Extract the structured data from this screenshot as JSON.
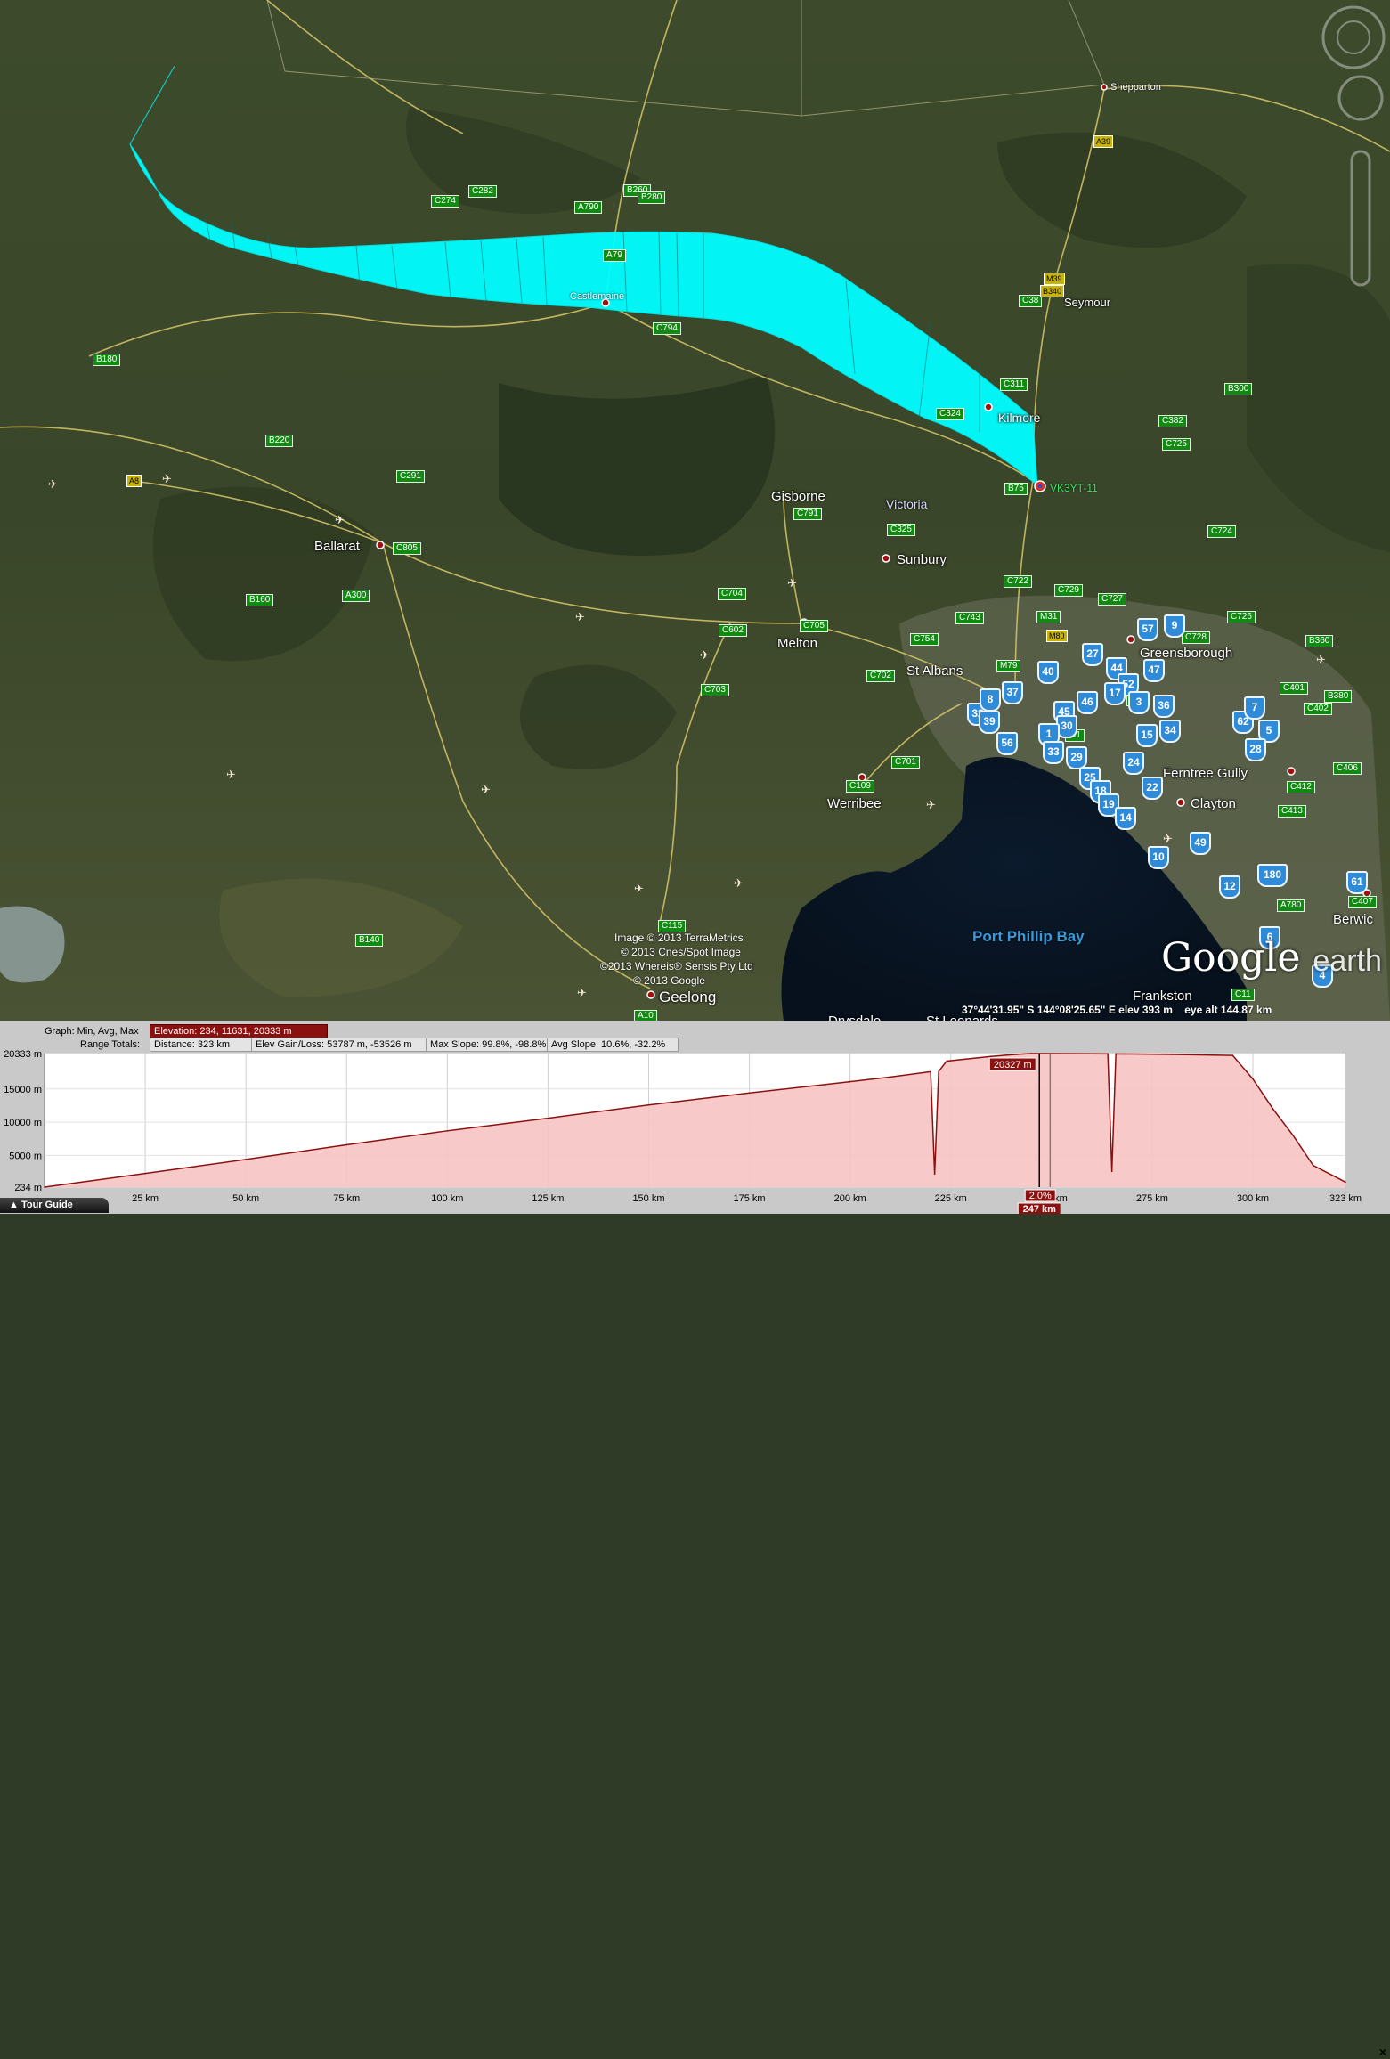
{
  "map": {
    "towns": [
      {
        "name": "Shepparton",
        "cls": "town-sm"
      },
      {
        "name": "Castlemaine",
        "cls": "town-sm"
      },
      {
        "name": "Seymour",
        "cls": "town"
      },
      {
        "name": "Kilmore",
        "cls": "town"
      },
      {
        "name": "Gisborne",
        "cls": "town"
      },
      {
        "name": "Victoria",
        "cls": "town"
      },
      {
        "name": "Sunbury",
        "cls": "town"
      },
      {
        "name": "Ballarat",
        "cls": "town"
      },
      {
        "name": "Melton",
        "cls": "town"
      },
      {
        "name": "St Albans",
        "cls": "town"
      },
      {
        "name": "Greensborough",
        "cls": "town"
      },
      {
        "name": "Ferntree Gully",
        "cls": "town"
      },
      {
        "name": "Clayton",
        "cls": "town"
      },
      {
        "name": "Werribee",
        "cls": "town"
      },
      {
        "name": "Geelong",
        "cls": "town"
      },
      {
        "name": "Frankston",
        "cls": "town"
      },
      {
        "name": "Berwic",
        "cls": "town"
      },
      {
        "name": "Drysdale",
        "cls": "town"
      },
      {
        "name": "St Leonards",
        "cls": "town"
      }
    ],
    "water_label": "Port Phillip Bay",
    "tracker_label": "VK3YT-11",
    "roads": [
      "C282",
      "C274",
      "B260",
      "B280",
      "A790",
      "A79",
      "C38",
      "B340",
      "M39",
      "A39",
      "C794",
      "B180",
      "C311",
      "C324",
      "B300",
      "C382",
      "C725",
      "B220",
      "A8",
      "C291",
      "B75",
      "C724",
      "C791",
      "C325",
      "C805",
      "C722",
      "C729",
      "C727",
      "A300",
      "C704",
      "B160",
      "C705",
      "C602",
      "C743",
      "M31",
      "M80",
      "C726",
      "C728",
      "B360",
      "C754",
      "M79",
      "C702",
      "C703",
      "M3",
      "M1",
      "C401",
      "B380",
      "C402",
      "C406",
      "C412",
      "C413",
      "C701",
      "C109",
      "A780",
      "C407",
      "B140",
      "C115",
      "A10",
      "C11"
    ],
    "poi_shields": [
      "57",
      "9",
      "27",
      "44",
      "47",
      "40",
      "52",
      "36",
      "37",
      "46",
      "62",
      "7",
      "32",
      "39",
      "45",
      "30",
      "15",
      "34",
      "5",
      "28",
      "56",
      "1",
      "33",
      "29",
      "24",
      "22",
      "25",
      "18",
      "19",
      "14",
      "49",
      "10",
      "180",
      "12",
      "61",
      "6",
      "4",
      "8",
      "3",
      "17"
    ],
    "credits": [
      "Image © 2013 TerraMetrics",
      "© 2013 Cnes/Spot Image",
      "©2013 Whereis® Sensis Pty Ltd",
      "© 2013 Google"
    ],
    "logo": {
      "main": "Google",
      "suffix": "earth"
    },
    "status": {
      "coords": "37°44'31.95\" S  144°08'25.65\" E  elev   393 m",
      "eye_alt": "eye alt 144.87 km"
    }
  },
  "graph": {
    "row1_label": "Graph: Min, Avg, Max",
    "elevation": "Elevation: 234, 11631, 20333 m",
    "row2_label": "Range Totals:",
    "distance": "Distance: 323 km",
    "elev_gain": "Elev Gain/Loss: 53787 m, -53526 m",
    "max_slope": "Max Slope: 99.8%, -98.8%",
    "avg_slope": "Avg Slope: 10.6%, -32.2%",
    "cursor_value": "20327 m",
    "cursor_slope": "2.0%",
    "cursor_km": "247 km",
    "tour_guide": "Tour Guide",
    "close": "×"
  },
  "chart_data": {
    "type": "area",
    "title": "",
    "xlabel": "",
    "ylabel": "",
    "x_unit": "km",
    "y_unit": "m",
    "xlim": [
      0,
      323
    ],
    "ylim": [
      234,
      20333
    ],
    "x_ticks": [
      "25 km",
      "50 km",
      "75 km",
      "100 km",
      "125 km",
      "150 km",
      "175 km",
      "200 km",
      "225 km",
      "250 km",
      "275 km",
      "300 km",
      "323 km"
    ],
    "y_ticks": [
      "20333 m",
      "15000 m",
      "10000 m",
      "5000 m",
      "234 m"
    ],
    "series": [
      {
        "x": [
          0,
          25,
          50,
          75,
          100,
          125,
          150,
          175,
          200,
          210,
          220,
          221,
          222,
          224,
          235,
          240,
          244,
          245,
          246,
          247,
          260,
          264,
          265,
          266,
          268,
          280,
          295,
          300,
          305,
          310,
          315,
          323
        ],
        "y": [
          234,
          2300,
          4400,
          6600,
          8700,
          10600,
          12600,
          14400,
          16100,
          16800,
          17600,
          2200,
          17650,
          19200,
          19900,
          20150,
          20300,
          20327,
          20333,
          20327,
          20300,
          20290,
          2600,
          20280,
          20270,
          20200,
          20050,
          16500,
          12000,
          8000,
          3500,
          1000
        ]
      }
    ],
    "grid": true,
    "color": "#8b1010",
    "fill": "#f6c3c3"
  }
}
